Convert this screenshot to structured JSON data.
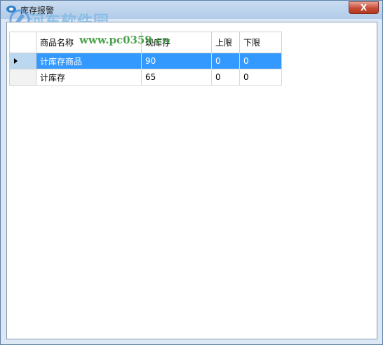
{
  "window": {
    "title": "库存报警",
    "close_label": "X"
  },
  "watermark": {
    "brand": "河东软件园",
    "url": "www.pc0359.cn"
  },
  "grid": {
    "columns": [
      "商品名称",
      "现库存",
      "上限",
      "下限"
    ],
    "rows": [
      {
        "name": "计库存商品",
        "stock": "90",
        "upper": "0",
        "lower": "0",
        "selected": true
      },
      {
        "name": "计库存",
        "stock": "65",
        "upper": "0",
        "lower": "0",
        "selected": false
      }
    ]
  },
  "colors": {
    "selection": "#3399ff",
    "titlebar": "#c9dcf1",
    "close_button": "#c74b35"
  }
}
